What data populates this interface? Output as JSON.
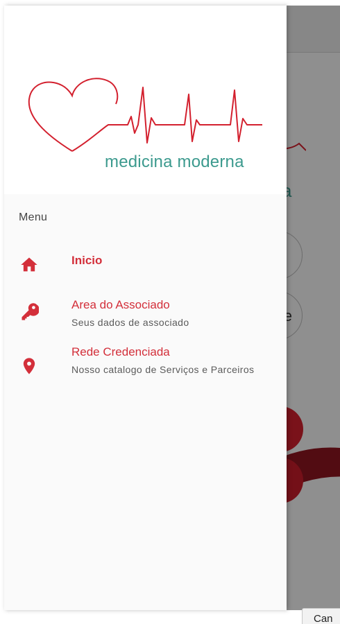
{
  "brand": {
    "name": "medicina moderna",
    "colors": {
      "primary_red": "#d32f3a",
      "teal": "#3c9a8e"
    },
    "logo_icon": "heart-ecg-icon"
  },
  "drawer": {
    "section_label": "Menu",
    "items": [
      {
        "icon": "home-icon",
        "title": "Inicio",
        "subtitle": "",
        "active": true
      },
      {
        "icon": "key-icon",
        "title": "Area do Associado",
        "subtitle": "Seus dados de associado",
        "active": false
      },
      {
        "icon": "location-pin-icon",
        "title": "Rede Credenciada",
        "subtitle": "Nosso catalogo de Serviços e Parceiros",
        "active": false
      }
    ]
  },
  "background": {
    "logo_fragment": "a",
    "button_fragment": "e"
  },
  "dialog": {
    "cancel_label": "Can"
  }
}
